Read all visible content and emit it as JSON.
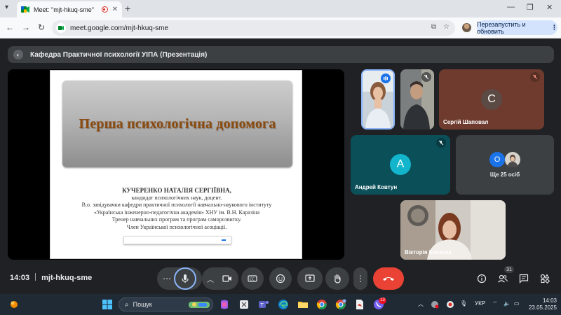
{
  "browser": {
    "tab_title": "Meet: \"mjt-hkuq-sme\"",
    "url": "meet.google.com/mjt-hkuq-sme",
    "relaunch_label": "Перезапустить и обновить"
  },
  "meeting": {
    "presentation_title": "Кафедра Практичної психології УІПА (Презентація)",
    "time": "14:03",
    "code": "mjt-hkuq-sme",
    "participants_count": "31"
  },
  "slide": {
    "title": "Перша психологічна допомога",
    "author_name": "КУЧЕРЕНКО НАТАЛІЯ СЕРГІЇВНА,",
    "lines": [
      "кандидат психологічних наук, доцент.",
      "В.о. завідувачки кафедри практичної психології навчально-наукового інституту",
      "«Українська інженерно-педагогічна академія» ХНУ ім. В.Н. Каразіна",
      "Тренер навчальних програм та програм саморозвитку.",
      "Член Української психологічної асоціації."
    ]
  },
  "tiles": {
    "sergii": {
      "initial": "С",
      "name": "Сергій Шаповал"
    },
    "andrii": {
      "initial": "А",
      "name": "Андрей Ковтун"
    },
    "others": {
      "initial": "О",
      "label": "Ще 25 осіб"
    },
    "viktoriia": {
      "name": "Вікторія Князєва"
    }
  },
  "taskbar": {
    "search_placeholder": "Пошук",
    "language": "УКР",
    "time": "14:03",
    "date": "23.05.2025",
    "badge": "13"
  },
  "colors": {
    "meet_bg": "#202124",
    "sergii_tile": "#6e3b2e",
    "andrii_tile": "#0b4f59",
    "hangup": "#ea4335",
    "slide_title": "#8a4b10"
  }
}
